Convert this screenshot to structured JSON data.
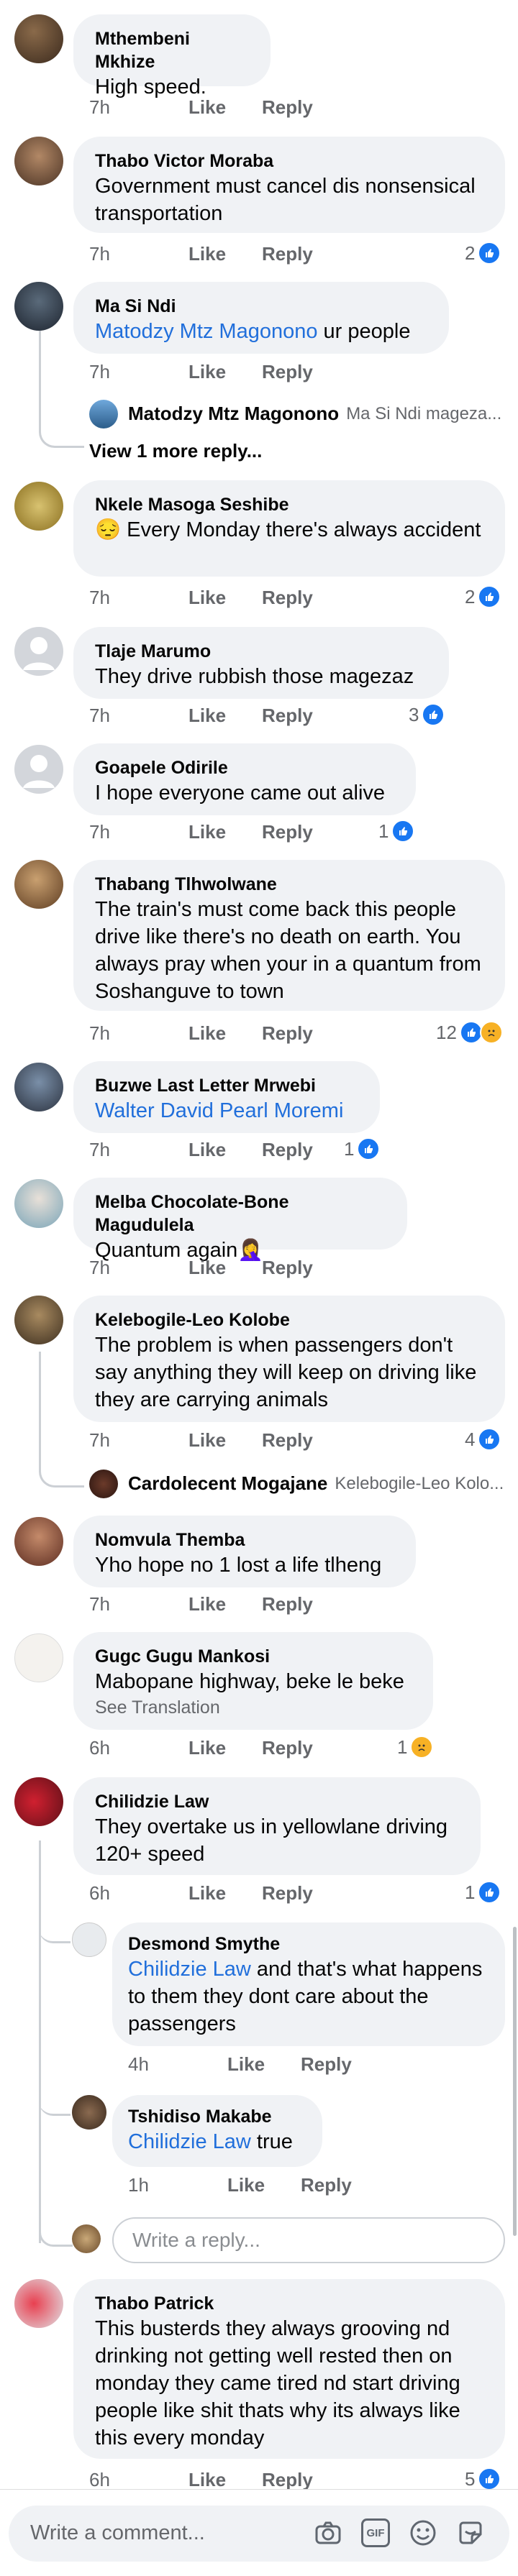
{
  "actions": {
    "like": "Like",
    "reply": "Reply"
  },
  "comments": [
    {
      "name": "Mthembeni Mkhize",
      "text": "High speed.",
      "time": "7h"
    },
    {
      "name": "Thabo Victor Moraba",
      "text": "Government must cancel dis nonsensical transportation",
      "time": "7h",
      "reactions": "2"
    },
    {
      "name": "Ma Si Ndi",
      "mention": "Matodzy Mtz Magonono",
      "text": " ur people",
      "time": "7h",
      "reply_preview": {
        "name": "Matodzy Mtz Magonono",
        "snippet": "Ma Si Ndi mageza..."
      },
      "more_replies": "View 1 more reply..."
    },
    {
      "name": "Nkele Masoga Seshibe",
      "emoji": "😔",
      "text": " Every Monday there's always accident",
      "time": "7h",
      "reactions": "2"
    },
    {
      "name": "Tlaje Marumo",
      "text": "They drive rubbish those magezaz",
      "time": "7h",
      "reactions": "3"
    },
    {
      "name": "Goapele Odirile",
      "text": "I hope everyone came out alive",
      "time": "7h",
      "reactions": "1"
    },
    {
      "name": "Thabang Tlhwolwane",
      "text": "The train's must come back this people drive like there's no death on earth.  You always pray when your in a quantum from Soshanguve to town",
      "time": "7h",
      "reactions": "12"
    },
    {
      "name": "Buzwe Last Letter Mrwebi",
      "mention": "Walter David Pearl Moremi",
      "text": "",
      "time": "7h",
      "reactions": "1"
    },
    {
      "name": "Melba Chocolate-Bone Magudulela",
      "text": "Quantum again",
      "emoji_after": "🤦‍♀️",
      "time": "7h"
    },
    {
      "name": "Kelebogile-Leo Kolobe",
      "text": "The problem is when passengers don't say anything they will keep on driving like they are carrying animals",
      "time": "7h",
      "reactions": "4",
      "reply_preview": {
        "name": "Cardolecent Mogajane",
        "snippet": "Kelebogile-Leo Kolo..."
      }
    },
    {
      "name": "Nomvula Themba",
      "text": "Yho hope no 1 lost a life tlheng",
      "time": "7h"
    },
    {
      "name": "Gugc Gugu Mankosi",
      "text": "Mabopane highway, beke le beke",
      "see_translation": "See Translation",
      "time": "6h",
      "reactions": "1"
    },
    {
      "name": "Chilidzie Law",
      "text": "They overtake us in yellowlane driving 120+ speed",
      "time": "6h",
      "reactions": "1"
    },
    {
      "name": "Thabo Patrick",
      "text": "This busterds they always grooving nd drinking not getting well rested then on monday they came tired nd start driving people like shit thats why its always like this every monday",
      "time": "6h",
      "reactions": "5"
    }
  ],
  "replies": [
    {
      "name": "Desmond Smythe",
      "mention": "Chilidzie Law",
      "text": " and that's  what happens to them they dont care about the passengers",
      "time": "4h"
    },
    {
      "name": "Tshidiso Makabe",
      "mention": "Chilidzie Law",
      "text": " true",
      "time": "1h"
    }
  ],
  "write_reply_placeholder": "Write a reply...",
  "write_comment_placeholder": "Write a comment...",
  "toolbar": {
    "gif": "GIF"
  }
}
